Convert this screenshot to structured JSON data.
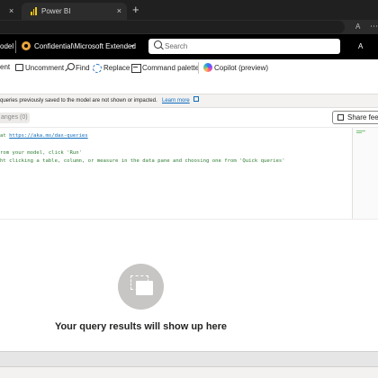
{
  "browser": {
    "tabs": [
      {
        "label": "",
        "close": "×"
      },
      {
        "label": "Power BI",
        "close": "×"
      }
    ],
    "new_tab": "+",
    "toolbar_icons": [
      "A",
      "⋯"
    ]
  },
  "header": {
    "model_label": "odel",
    "sensitivity_label": "Confidential\\Microsoft Extended",
    "chevron": "⌄",
    "search_placeholder": "Search",
    "right_label": "A"
  },
  "ribbon": {
    "items": [
      {
        "label": "ent"
      },
      {
        "label": "Uncomment"
      },
      {
        "label": "Find"
      },
      {
        "label": "Replace"
      },
      {
        "label": "Command palette"
      },
      {
        "label": "Copilot (preview)"
      }
    ]
  },
  "info_bar": {
    "text": "queries previously saved to the model are not shown or impacted.",
    "link": "Learn more"
  },
  "query_tabs": {
    "changes_label": "anges (0)",
    "share_label": "Share feedback"
  },
  "editor": {
    "lines": [
      {
        "prefix": "at ",
        "link": "https://aka.ms/dax-queries",
        "suffix": ""
      },
      {
        "prefix": "rom your model, click 'Run'",
        "link": "",
        "suffix": ""
      },
      {
        "prefix": "ht clicking a table, column, or measure in the data pane and choosing one from 'Quick queries'",
        "link": "",
        "suffix": ""
      }
    ]
  },
  "results": {
    "empty_title": "Your query results will show up here",
    "empty_icon": "query-results-icon"
  },
  "colors": {
    "header_bg": "#000000",
    "browser_bg": "#202020",
    "comment_green": "#2e7d32",
    "link_blue": "#0f6cbd",
    "sensitivity_orange": "#e8a33d"
  }
}
